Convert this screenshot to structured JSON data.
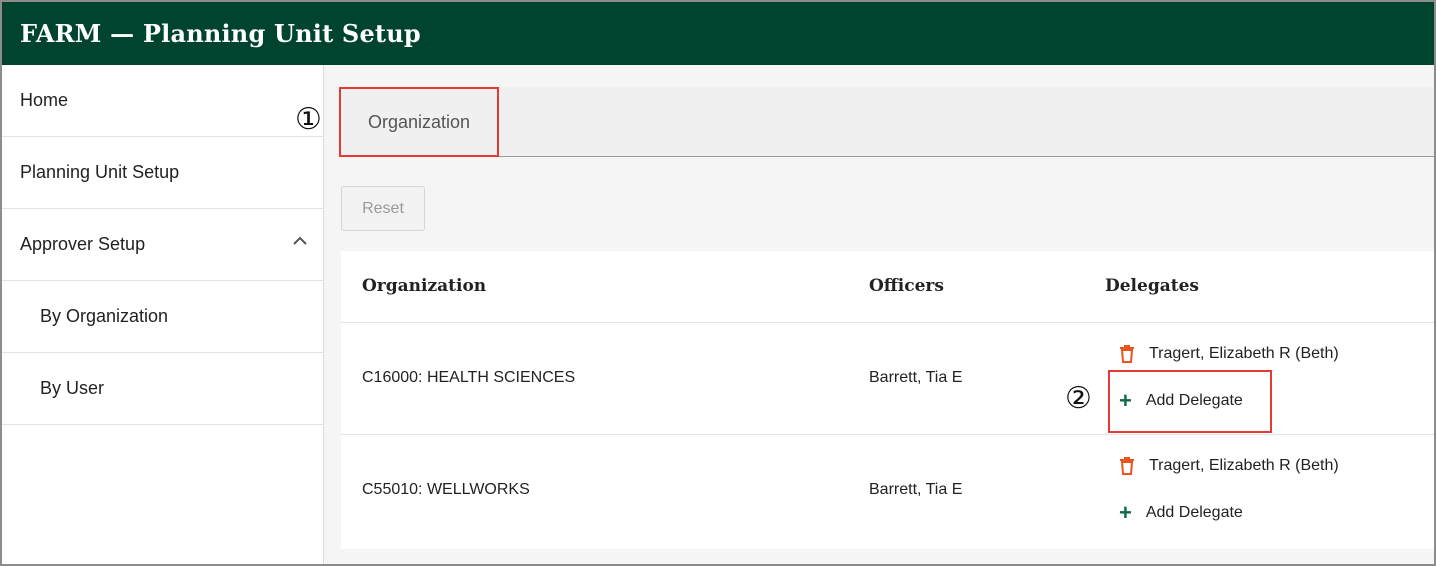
{
  "header": {
    "title": "FARM  —  Planning Unit Setup"
  },
  "sidebar": {
    "items": [
      {
        "label": "Home"
      },
      {
        "label": "Planning Unit Setup"
      },
      {
        "label": "Approver Setup"
      },
      {
        "label": "By Organization"
      },
      {
        "label": "By User"
      }
    ]
  },
  "tabs": [
    {
      "label": "Organization"
    }
  ],
  "markers": {
    "one": "①",
    "two": "②"
  },
  "toolbar": {
    "reset_label": "Reset"
  },
  "table": {
    "columns": [
      "Organization",
      "Officers",
      "Delegates"
    ],
    "rows": [
      {
        "organization": "C16000: HEALTH SCIENCES",
        "officer": "Barrett, Tia E",
        "delegate": "Tragert, Elizabeth R (Beth)",
        "add_label": "Add Delegate"
      },
      {
        "organization": "C55010: WELLWORKS",
        "officer": "Barrett, Tia E",
        "delegate": "Tragert, Elizabeth R (Beth)",
        "add_label": "Add Delegate"
      }
    ]
  },
  "icons": {
    "plus": "+"
  },
  "colors": {
    "header_bg": "#004430",
    "annotation": "#e53935",
    "trash": "#e8541e",
    "plus": "#0a6a4a"
  }
}
